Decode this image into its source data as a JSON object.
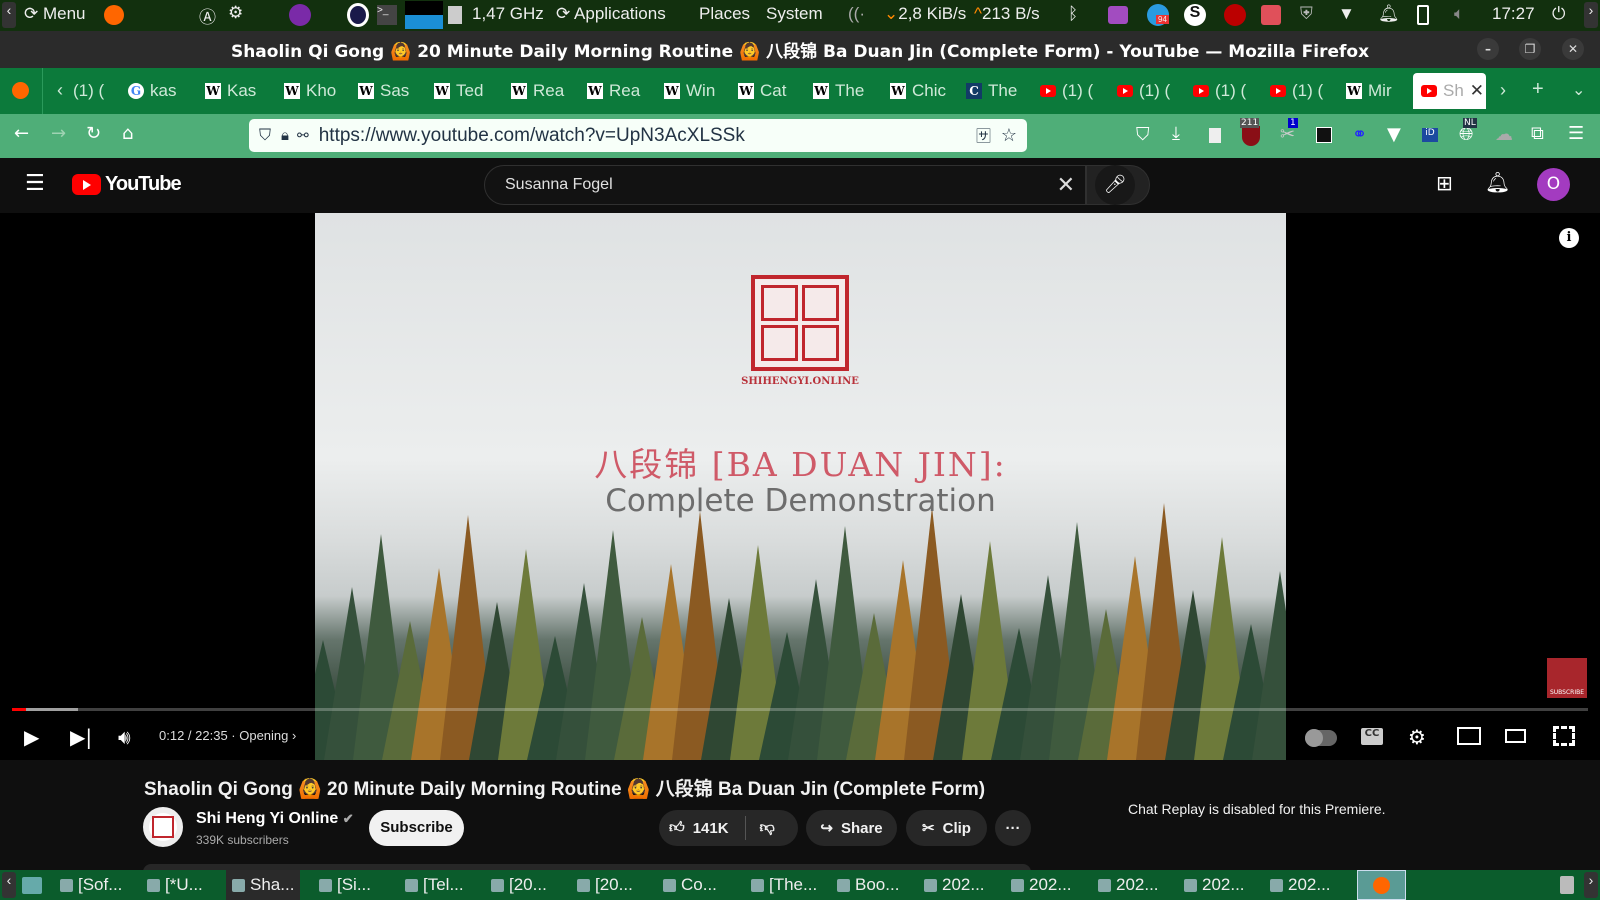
{
  "panel": {
    "menu": "Menu",
    "cpu": "1,47 GHz",
    "applications": "Applications",
    "places": "Places",
    "system": "System",
    "net_down": "2,8 KiB/s",
    "net_up": "213 B/s",
    "badge": "94",
    "clock": "17:27"
  },
  "window": {
    "title": "Shaolin Qi Gong 🙆 20 Minute Daily Morning Routine 🙆 八段锦 Ba Duan Jin (Complete Form) - YouTube — Mozilla Firefox"
  },
  "tabs": [
    {
      "label": "(1) (",
      "icon": "none"
    },
    {
      "label": "kas",
      "icon": "google"
    },
    {
      "label": "Kas",
      "icon": "W"
    },
    {
      "label": "Kho",
      "icon": "W"
    },
    {
      "label": "Sas",
      "icon": "W"
    },
    {
      "label": "Ted",
      "icon": "W"
    },
    {
      "label": "Rea",
      "icon": "W"
    },
    {
      "label": "Rea",
      "icon": "W"
    },
    {
      "label": "Win",
      "icon": "W"
    },
    {
      "label": "Cat",
      "icon": "W"
    },
    {
      "label": "The",
      "icon": "W"
    },
    {
      "label": "Chic",
      "icon": "W"
    },
    {
      "label": "The",
      "icon": "C"
    },
    {
      "label": "(1) (",
      "icon": "yt"
    },
    {
      "label": "(1) (",
      "icon": "yt"
    },
    {
      "label": "(1) (",
      "icon": "yt"
    },
    {
      "label": "(1) (",
      "icon": "yt"
    },
    {
      "label": "Mir",
      "icon": "W"
    },
    {
      "label": "Sh",
      "icon": "yt",
      "active": true
    }
  ],
  "nav": {
    "url": "https://www.youtube.com/watch?v=UpN3AcXLSSk",
    "ext_badge_1": "211",
    "ext_badge_2": "1",
    "ext_badge_3": "NL"
  },
  "youtube": {
    "logo": "YouTube",
    "search_value": "Susanna Fogel",
    "avatar": "O"
  },
  "video": {
    "logo_text": "SHIHENGYI.ONLINE",
    "title_cn": "八段锦 [BA DUAN JIN]:",
    "title_en": "Complete Demonstration",
    "time": "0:12 / 22:35",
    "chapter": "Opening",
    "progress_played": 0.009,
    "progress_buffered": 0.042,
    "subscribe_watermark": "SUBSCRIBE"
  },
  "details": {
    "title": "Shaolin Qi Gong 🙆 20 Minute Daily Morning Routine 🙆 八段锦 Ba Duan Jin (Complete Form)",
    "channel": "Shi Heng Yi Online",
    "subscribers": "339K subscribers",
    "subscribe": "Subscribe",
    "likes": "141K",
    "share": "Share",
    "clip": "Clip",
    "more": "···",
    "chat_notice": "Chat Replay is disabled for this Premiere."
  },
  "taskbar": [
    "[Sof...",
    "[*U...",
    "Sha...",
    "[Si...",
    "[Tel...",
    "[20...",
    "[20...",
    "Co...",
    "[The...",
    "Boo...",
    "202...",
    "202...",
    "202...",
    "202...",
    "202..."
  ]
}
